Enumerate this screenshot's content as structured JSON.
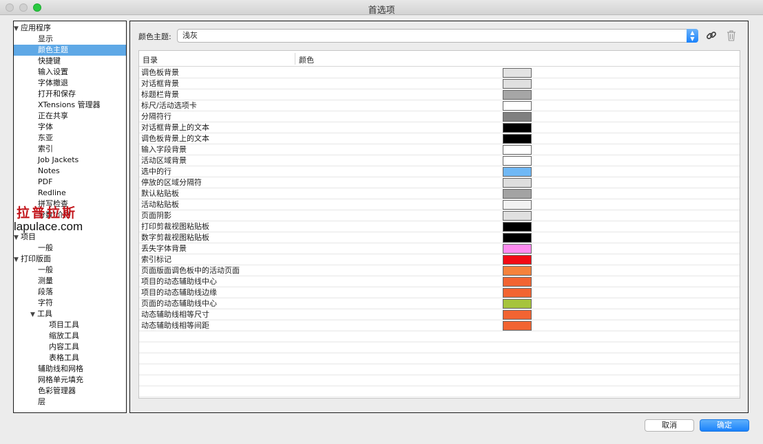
{
  "window": {
    "title": "首选项"
  },
  "sidebar": {
    "items": [
      {
        "label": "应用程序",
        "level": 0,
        "expanded": true,
        "selected": false
      },
      {
        "label": "显示",
        "level": 1,
        "selected": false
      },
      {
        "label": "颜色主题",
        "level": 1,
        "selected": true
      },
      {
        "label": "快捷键",
        "level": 1,
        "selected": false
      },
      {
        "label": "输入设置",
        "level": 1,
        "selected": false
      },
      {
        "label": "字体撤退",
        "level": 1,
        "selected": false
      },
      {
        "label": "打开和保存",
        "level": 1,
        "selected": false
      },
      {
        "label": "XTensions 管理器",
        "level": 1,
        "selected": false
      },
      {
        "label": "正在共享",
        "level": 1,
        "selected": false
      },
      {
        "label": "字体",
        "level": 1,
        "selected": false
      },
      {
        "label": "东亚",
        "level": 1,
        "selected": false
      },
      {
        "label": "索引",
        "level": 1,
        "selected": false
      },
      {
        "label": "Job Jackets",
        "level": 1,
        "selected": false
      },
      {
        "label": "Notes",
        "level": 1,
        "selected": false
      },
      {
        "label": "PDF",
        "level": 1,
        "selected": false
      },
      {
        "label": "Redline",
        "level": 1,
        "selected": false
      },
      {
        "label": "拼写检查",
        "level": 1,
        "selected": false
      },
      {
        "label": "分数/价格",
        "level": 1,
        "selected": false
      },
      {
        "label": "",
        "level": 1,
        "selected": false
      },
      {
        "label": "项目",
        "level": 0,
        "expanded": true,
        "selected": false
      },
      {
        "label": "一般",
        "level": 1,
        "selected": false
      },
      {
        "label": "打印版面",
        "level": 0,
        "expanded": true,
        "selected": false
      },
      {
        "label": "一般",
        "level": 1,
        "selected": false
      },
      {
        "label": "测量",
        "level": 1,
        "selected": false
      },
      {
        "label": "段落",
        "level": 1,
        "selected": false
      },
      {
        "label": "字符",
        "level": 1,
        "selected": false
      },
      {
        "label": "工具",
        "level": 1,
        "expanded": true,
        "selected": false
      },
      {
        "label": "项目工具",
        "level": 2,
        "selected": false
      },
      {
        "label": "缩放工具",
        "level": 2,
        "selected": false
      },
      {
        "label": "内容工具",
        "level": 2,
        "selected": false
      },
      {
        "label": "表格工具",
        "level": 2,
        "selected": false
      },
      {
        "label": "辅助线和网格",
        "level": 1,
        "selected": false
      },
      {
        "label": "网格单元填充",
        "level": 1,
        "selected": false
      },
      {
        "label": "色彩管理器",
        "level": 1,
        "selected": false
      },
      {
        "label": "层",
        "level": 1,
        "selected": false
      }
    ]
  },
  "watermark": {
    "cn": "拉普拉斯",
    "en": "lapulace.com"
  },
  "theme": {
    "label": "颜色主题:",
    "value": "浅灰"
  },
  "table": {
    "headers": [
      "目录",
      "颜色"
    ],
    "rows": [
      {
        "name": "调色板背景",
        "color": "#e3e3e3"
      },
      {
        "name": "对话框背景",
        "color": "#e0e0e0"
      },
      {
        "name": "标题栏背景",
        "color": "#a6a6a6"
      },
      {
        "name": "标尺/活动选项卡",
        "color": "#ffffff"
      },
      {
        "name": "分隔符行",
        "color": "#808080"
      },
      {
        "name": "对话框背景上的文本",
        "color": "#000000"
      },
      {
        "name": "调色板背景上的文本",
        "color": "#000000"
      },
      {
        "name": "输入字段背景",
        "color": "#ffffff"
      },
      {
        "name": "活动区域背景",
        "color": "#ffffff"
      },
      {
        "name": "选中的行",
        "color": "#70b8f5"
      },
      {
        "name": "停放的区域分隔符",
        "color": "#dedede"
      },
      {
        "name": "默认粘贴板",
        "color": "#a3a3a3"
      },
      {
        "name": "活动粘贴板",
        "color": "#f2f2f2"
      },
      {
        "name": "页面阴影",
        "color": "#e0e0e0"
      },
      {
        "name": "打印剪裁视图粘贴板",
        "color": "#000000"
      },
      {
        "name": "数字剪裁视图粘贴板",
        "color": "#000000"
      },
      {
        "name": "丢失字体背景",
        "color": "#ff8cf0"
      },
      {
        "name": "索引标记",
        "color": "#f20a14"
      },
      {
        "name": "页面版面调色板中的活动页面",
        "color": "#f5823c"
      },
      {
        "name": "项目的动态辅助线中心",
        "color": "#f26432"
      },
      {
        "name": "项目的动态辅助线边缘",
        "color": "#f26432"
      },
      {
        "name": "页面的动态辅助线中心",
        "color": "#a6c43c"
      },
      {
        "name": "动态辅助线相等尺寸",
        "color": "#f26432"
      },
      {
        "name": "动态辅助线相等间距",
        "color": "#f26432"
      }
    ],
    "empty_rows": 6
  },
  "buttons": {
    "cancel": "取消",
    "ok": "确定"
  }
}
